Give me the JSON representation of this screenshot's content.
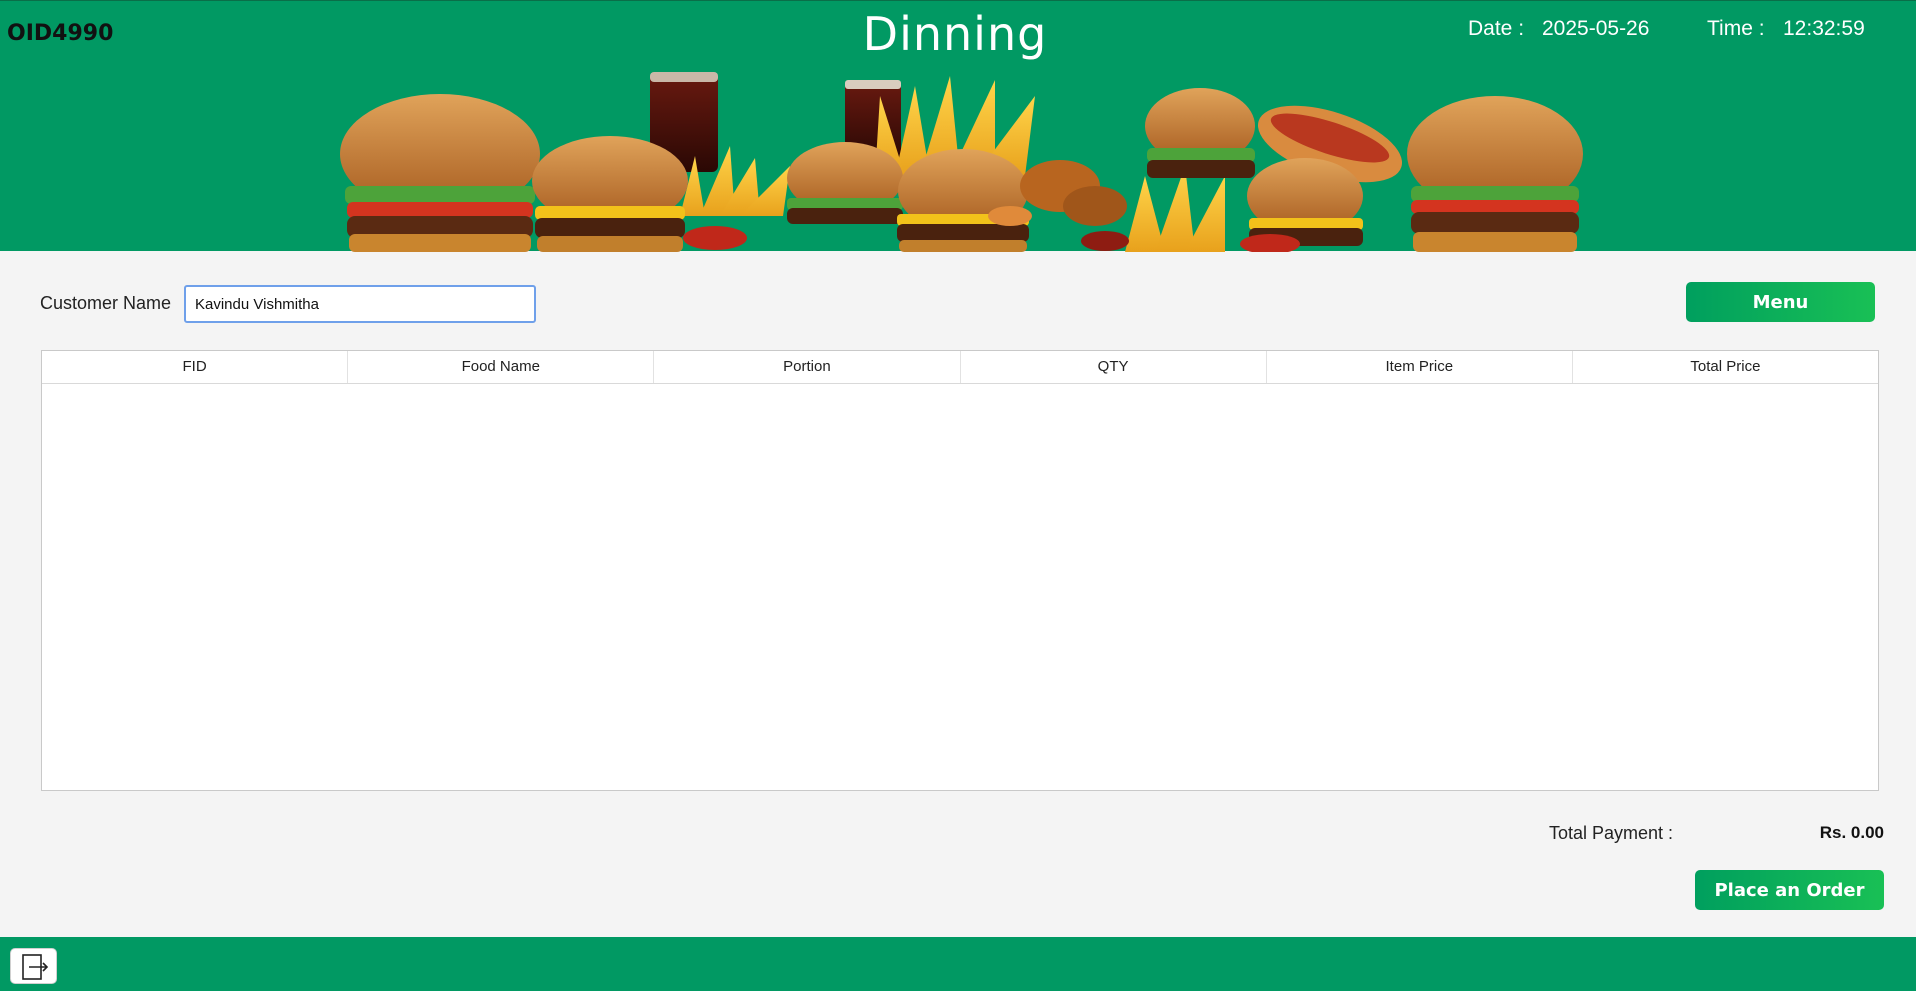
{
  "header": {
    "order_id": "OID4990",
    "title": "Dinning",
    "date_label": "Date :",
    "date_value": "2025-05-26",
    "time_label": "Time :",
    "time_value": "12:32:59"
  },
  "customer": {
    "label": "Customer Name",
    "value": "Kavindu Vishmitha"
  },
  "buttons": {
    "menu": "Menu",
    "place_order": "Place an Order"
  },
  "table": {
    "columns": [
      "FID",
      "Food Name",
      "Portion",
      "QTY",
      "Item Price",
      "Total Price"
    ],
    "rows": []
  },
  "summary": {
    "total_label": "Total Payment :",
    "total_value": "Rs. 0.00"
  },
  "icons": {
    "logout": "logout-icon"
  },
  "colors": {
    "primary_green": "#019963",
    "button_gradient_start": "#009f5e",
    "button_gradient_end": "#19c055"
  }
}
